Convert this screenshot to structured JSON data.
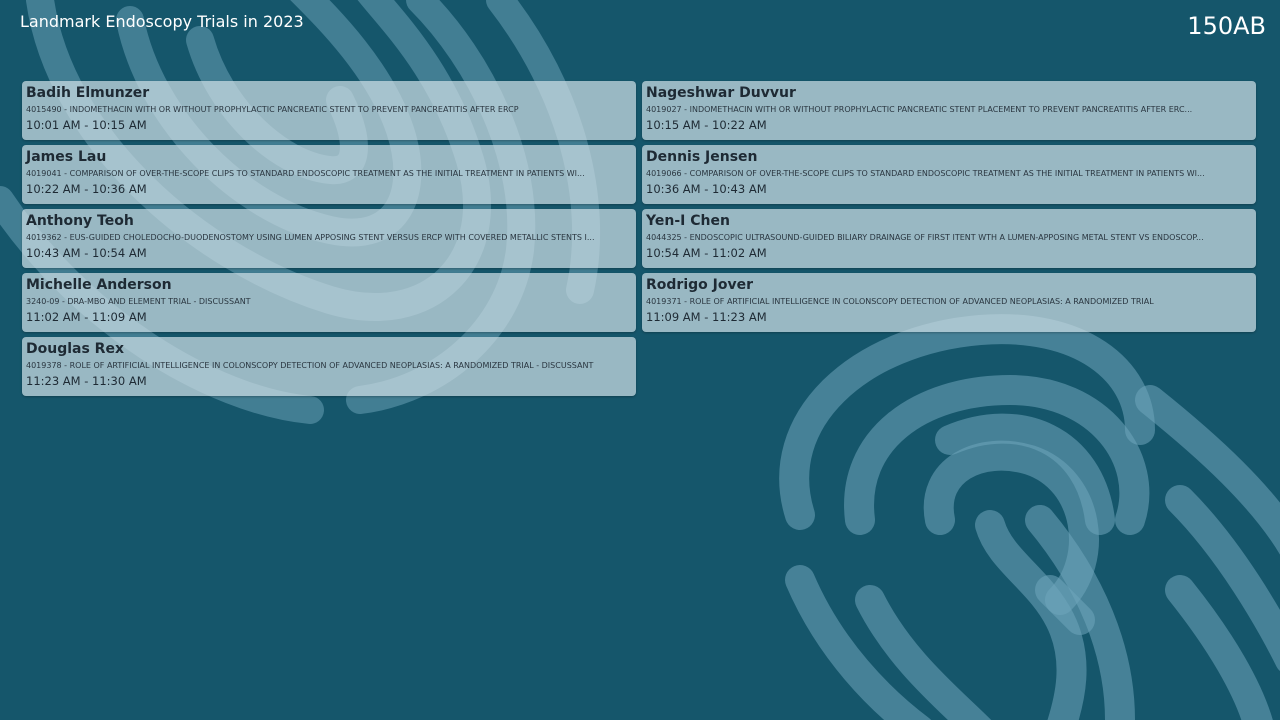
{
  "header": {
    "title": "Landmark Endoscopy Trials in 2023",
    "room": "150AB"
  },
  "colors": {
    "background": "#15566b",
    "card": "#cddee5",
    "art": "#6fa6bb"
  },
  "sessions": [
    {
      "speaker": "Badih Elmunzer",
      "talk": "4015490 - INDOMETHACIN WITH OR WITHOUT PROPHYLACTIC PANCREATIC STENT TO PREVENT PANCREATITIS AFTER ERCP",
      "time": "10:01 AM - 10:15 AM"
    },
    {
      "speaker": "Nageshwar Duvvur",
      "talk": "4019027 - INDOMETHACIN WITH OR WITHOUT PROPHYLACTIC PANCREATIC STENT PLACEMENT TO PREVENT PANCREATITIS AFTER ERC...",
      "time": "10:15 AM - 10:22 AM"
    },
    {
      "speaker": "James Lau",
      "talk": "4019041 - COMPARISON OF OVER-THE-SCOPE CLIPS TO STANDARD ENDOSCOPIC TREATMENT AS THE INITIAL TREATMENT IN PATIENTS WI...",
      "time": "10:22 AM - 10:36 AM"
    },
    {
      "speaker": "Dennis Jensen",
      "talk": "4019066 - COMPARISON OF OVER-THE-SCOPE CLIPS TO STANDARD ENDOSCOPIC TREATMENT AS THE INITIAL TREATMENT IN PATIENTS WI...",
      "time": "10:36 AM - 10:43 AM"
    },
    {
      "speaker": "Anthony Teoh",
      "talk": "4019362 - EUS-GUIDED CHOLEDOCHO-DUODENOSTOMY USING LUMEN APPOSING STENT VERSUS ERCP WITH COVERED METALLIC STENTS I...",
      "time": "10:43 AM - 10:54 AM"
    },
    {
      "speaker": "Yen-I Chen",
      "talk": "4044325 - ENDOSCOPIC ULTRASOUND-GUIDED BILIARY DRAINAGE OF FIRST ITENT WTH A LUMEN-APPOSING METAL STENT VS ENDOSCOP...",
      "time": "10:54 AM - 11:02 AM"
    },
    {
      "speaker": "Michelle Anderson",
      "talk": "3240-09 - DRA-MBO AND ELEMENT TRIAL - DISCUSSANT",
      "time": "11:02 AM - 11:09 AM"
    },
    {
      "speaker": "Rodrigo Jover",
      "talk": "4019371 - ROLE OF ARTIFICIAL INTELLIGENCE IN COLONSCOPY DETECTION OF ADVANCED NEOPLASIAS: A RANDOMIZED TRIAL",
      "time": "11:09 AM - 11:23 AM"
    },
    {
      "speaker": "Douglas Rex",
      "talk": "4019378 - ROLE OF ARTIFICIAL INTELLIGENCE IN COLONSCOPY DETECTION OF ADVANCED NEOPLASIAS: A RANDOMIZED TRIAL - DISCUSSANT",
      "time": "11:23 AM - 11:30 AM"
    }
  ]
}
